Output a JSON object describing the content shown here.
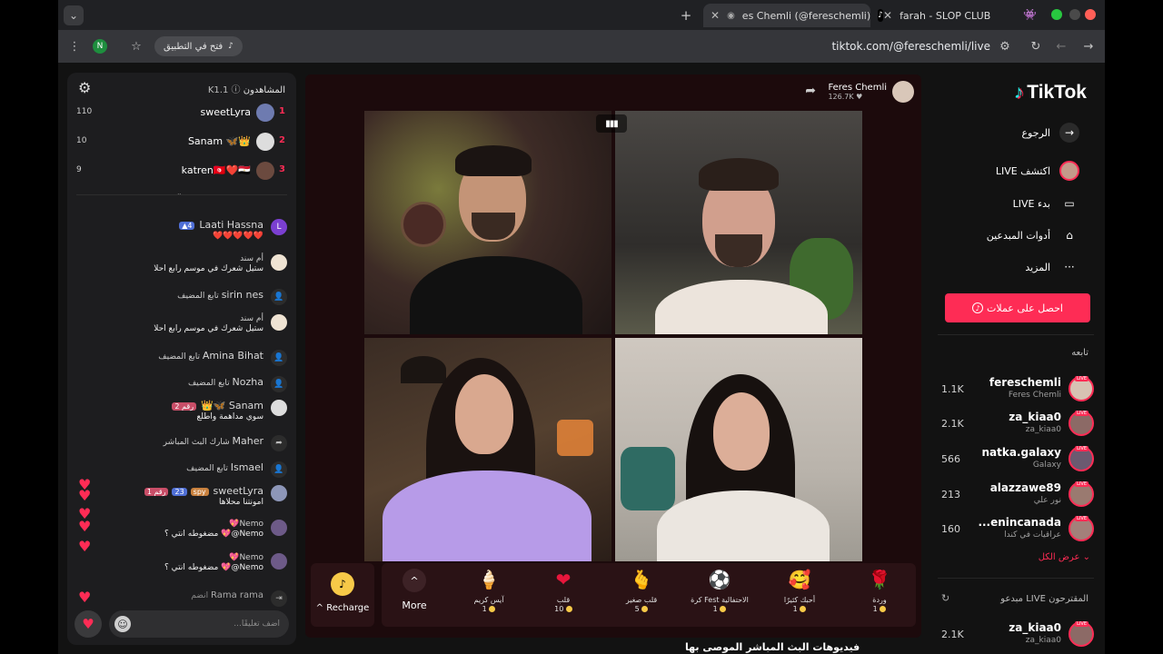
{
  "browser": {
    "tabs": [
      {
        "label": "es Chemli (@fereschemli)",
        "active": true
      },
      {
        "label": "farah - SLOP CLUB",
        "active": false
      }
    ],
    "url": "tiktok.com/@fereschemli/live",
    "open_in_app": "فتح في التطبيق",
    "profile_letter": "N",
    "new_tab": "+"
  },
  "nav": {
    "logo": "TikTok",
    "items": [
      {
        "label": "الرجوع",
        "icon": "→"
      },
      {
        "label": "اكتشف LIVE",
        "icon": ""
      },
      {
        "label": "بدء LIVE",
        "icon": "▭"
      },
      {
        "label": "أدوات المبدعين",
        "icon": "⌂"
      },
      {
        "label": "المزيد",
        "icon": "···"
      }
    ],
    "coins_button": "احصل على عملات",
    "following_title": "تابعه",
    "following": [
      {
        "name": "fereschemli",
        "sub": "Feres Chemli",
        "count": "1.1K"
      },
      {
        "name": "za_kiaa0",
        "sub": "za_kiaa0",
        "count": "2.1K"
      },
      {
        "name": "natka.galaxy",
        "sub": "Galaxy",
        "count": "566"
      },
      {
        "name": "alazzawe89",
        "sub": "نور علي",
        "count": "213"
      },
      {
        "name": "...enincanada",
        "sub": "عراقيات في كندا",
        "count": "160"
      }
    ],
    "show_all": "عرض الكل",
    "suggested_title": "مبدعو LIVE المقترحون",
    "suggested": [
      {
        "name": "za_kiaa0",
        "sub": "za_kiaa0",
        "count": "2.1K"
      }
    ],
    "live_badge": "LIVE"
  },
  "stream": {
    "host_name": "Feres Chemli",
    "host_count": "126.7K",
    "recharge": "Recharge",
    "more": "More",
    "gifts": [
      {
        "name": "وردة",
        "price": "1",
        "icon": "🌹"
      },
      {
        "name": "أحبك كثيرًا",
        "price": "1",
        "icon": "🥰"
      },
      {
        "name": "كرة Fest الاحتفالية",
        "price": "1",
        "icon": "⚽"
      },
      {
        "name": "قلب صغير",
        "price": "5",
        "icon": "🫰"
      },
      {
        "name": "قلب",
        "price": "10",
        "icon": "❤"
      },
      {
        "name": "آيس كريم",
        "price": "1",
        "icon": "🍦"
      }
    ],
    "bottom_title": "فيديوهات البث المباشر الموصى بها"
  },
  "chat": {
    "viewers_label": "المشاهدون",
    "viewers_count": "K1.1",
    "ranking": [
      {
        "rank": "1",
        "name": "sweetLyra",
        "score": "110"
      },
      {
        "rank": "2",
        "name": "Sanam 🦋👑",
        "score": "10"
      },
      {
        "rank": "3",
        "name": "katren🇹🇳❤️🇪🇬",
        "score": "9"
      }
    ],
    "messages": [
      {
        "user": "Laati Hassna",
        "level": "4",
        "text": "❤️❤️❤️❤️❤️"
      },
      {
        "user": "أم سند",
        "text": "ستيل شعرك في موسم رابع احلا"
      },
      {
        "user": "sirin nes",
        "text": "تابع المضيف",
        "system": true
      },
      {
        "user": "أم سند",
        "text": "ستيل شعرك في موسم رابع احلا"
      },
      {
        "user": "Amina Bihat",
        "text": "تابع المضيف",
        "system": true
      },
      {
        "user": "Nozha",
        "text": "تابع المضيف",
        "system": true
      },
      {
        "user": "Sanam 🦋👑",
        "level": "رقم 2",
        "text": "سوي مداهمة واطلع"
      },
      {
        "user": "Maher",
        "text": "شارك البث المباشر",
        "system": true
      },
      {
        "user": "Ismael",
        "text": "تابع المضيف",
        "system": true
      },
      {
        "user": "sweetLyra",
        "level": "رقم 1",
        "level2": "23",
        "tag": "spy",
        "text": "امونتنا محلاها"
      },
      {
        "user": "Nemo💖",
        "text": "Nemo@💖 مضغوطه انتي ؟"
      },
      {
        "user": "Nemo💖",
        "text": "Nemo@💖 مضغوطه انتي ؟"
      },
      {
        "user": "Rama rama",
        "text": "انضم",
        "system": true
      }
    ],
    "comment_placeholder": "أضف تعليقًا..."
  }
}
